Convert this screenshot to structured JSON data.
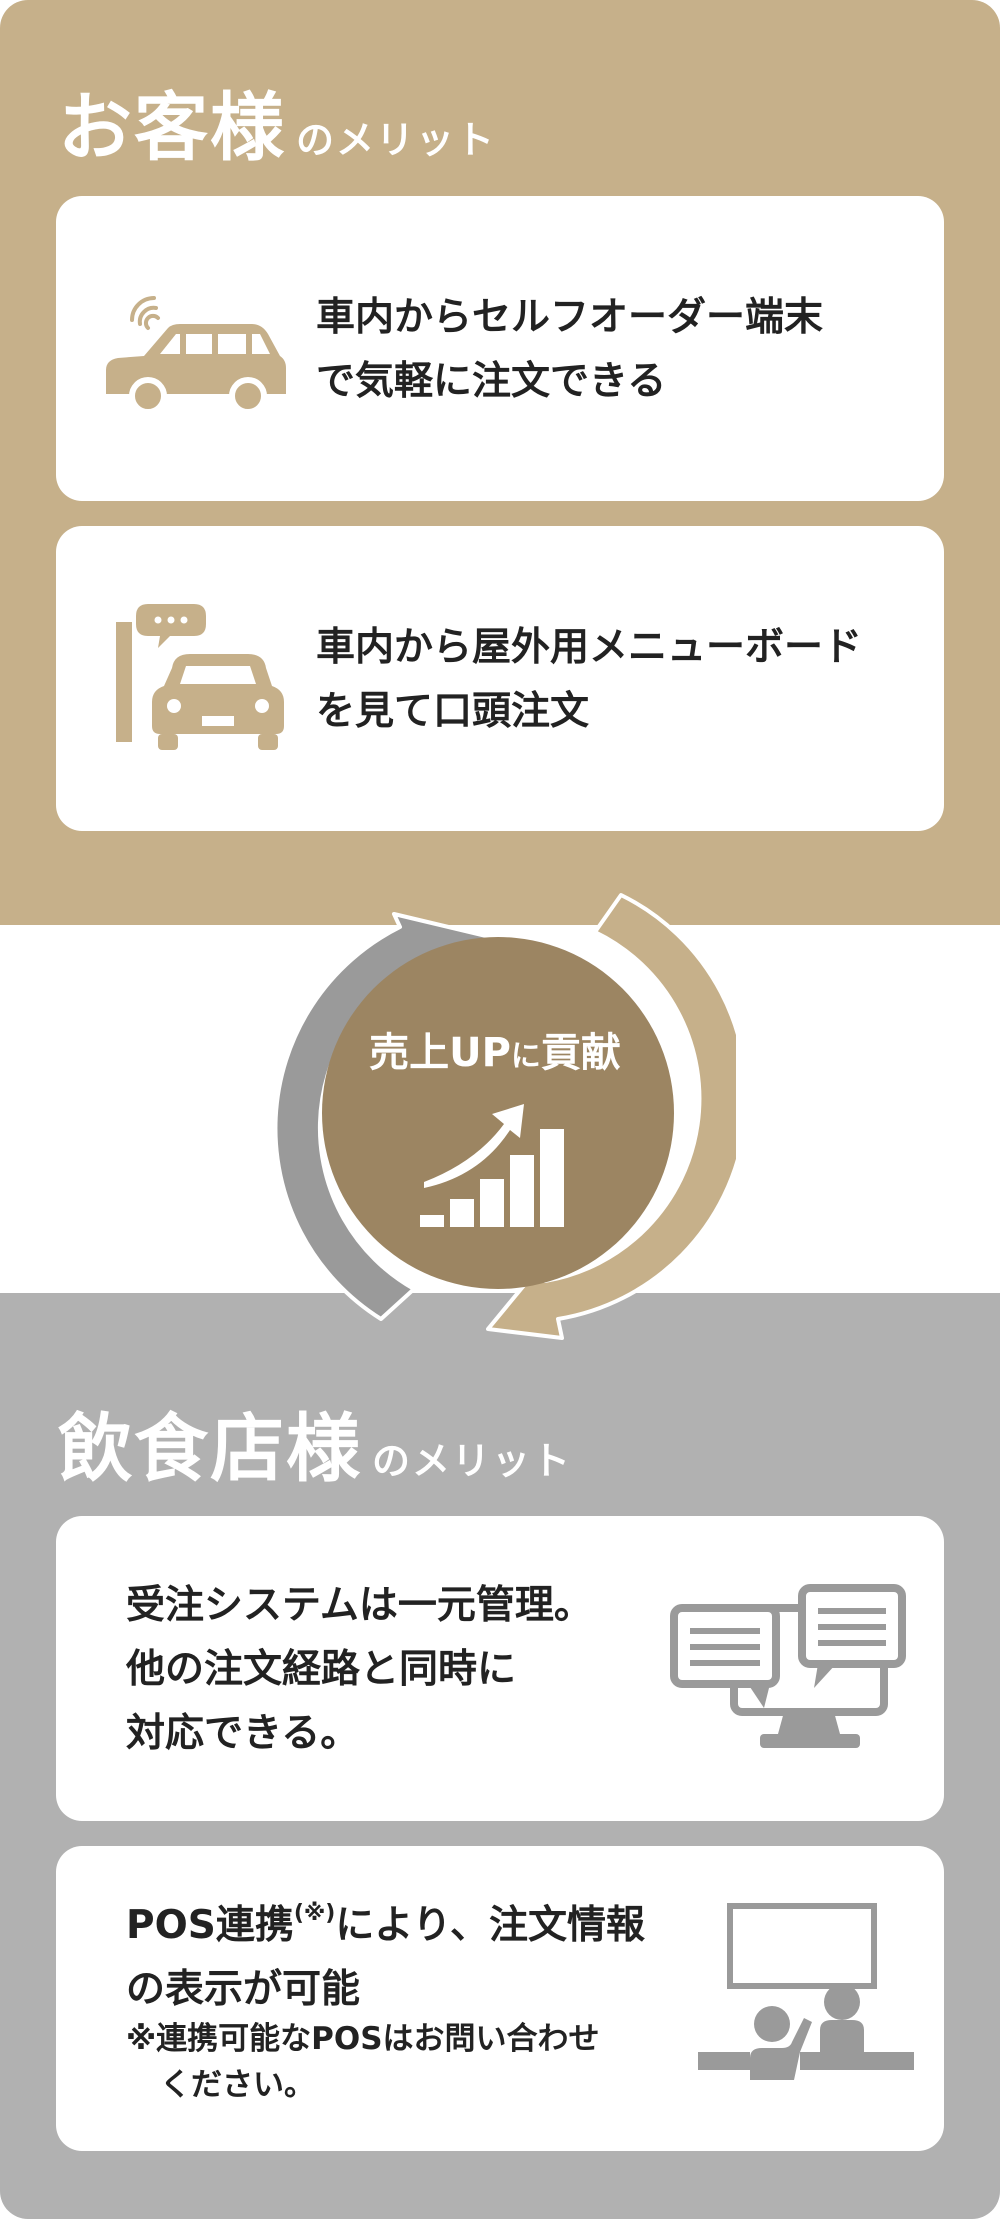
{
  "customer": {
    "heading_main": "お客様",
    "heading_sub": "のメリット",
    "cards": [
      {
        "line1": "車内からセルフオーダー端末",
        "line2": "で気軽に注文できる",
        "icon": "connected-car-icon"
      },
      {
        "line1": "車内から屋外用メニューボード",
        "line2": "を見て口頭注文",
        "icon": "car-menu-board-icon"
      }
    ]
  },
  "center": {
    "label_a": "売上UP",
    "label_b": "に",
    "label_c": "貢献",
    "icon": "sales-growth-chart-icon"
  },
  "restaurant": {
    "heading_main": "飲食店様",
    "heading_sub": "のメリット",
    "cards": [
      {
        "line1": "受注システムは一元管理。",
        "line2": "他の注文経路と同時に",
        "line3": "対応できる。",
        "icon": "monitor-chat-icon"
      },
      {
        "line1_a": "POS連携",
        "line1_mark": "(※)",
        "line1_b": "により、注文情報",
        "line2": "の表示が可能",
        "note1": "※連携可能なPOSはお問い合わせ",
        "note2": "ください。",
        "icon": "presentation-icon"
      }
    ]
  },
  "colors": {
    "customer_panel": "#c6b08a",
    "restaurant_panel": "#b1b1b1",
    "center_circle": "#9c8562",
    "arrow_gray": "#9a9a9a",
    "arrow_tan": "#c6b08a"
  }
}
